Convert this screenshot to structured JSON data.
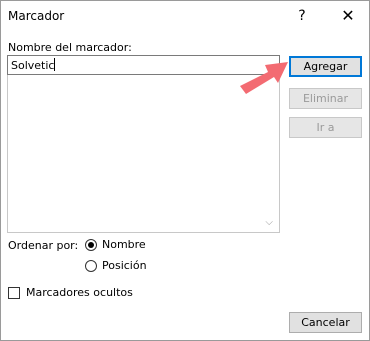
{
  "window": {
    "title": "Marcador",
    "help_glyph": "?",
    "close_glyph": "✕"
  },
  "form": {
    "name_label": "Nombre del marcador:",
    "name_value": "Solvetic",
    "order_label": "Ordenar por:",
    "sort_options": [
      {
        "label": "Nombre",
        "selected": true
      },
      {
        "label": "Posición",
        "selected": false
      }
    ],
    "hidden_label": "Marcadores ocultos",
    "hidden_checked": false
  },
  "buttons": {
    "add": "Agregar",
    "delete": "Eliminar",
    "goto": "Ir a",
    "cancel": "Cancelar"
  },
  "colors": {
    "accent": "#0078d7",
    "arrow": "#f36b72"
  }
}
